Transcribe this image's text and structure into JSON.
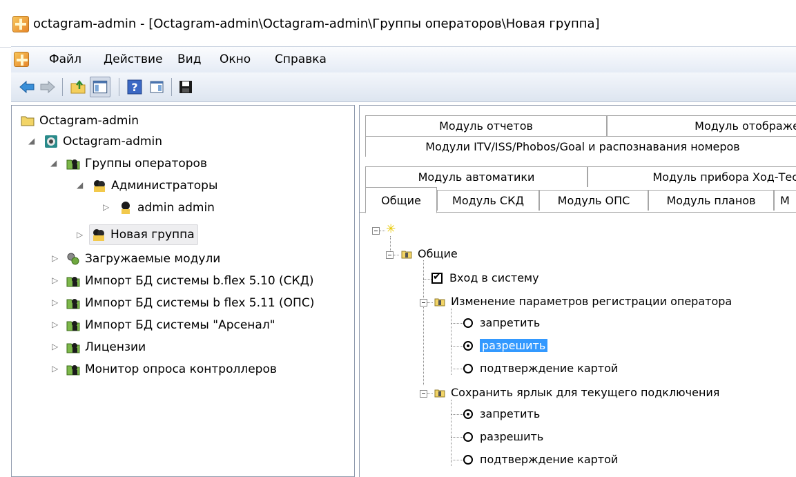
{
  "window": {
    "title": "octagram-admin - [Octagram-admin\\Octagram-admin\\Группы операторов\\Новая группа]"
  },
  "menu": {
    "items": [
      "Файл",
      "Действие",
      "Вид",
      "Окно",
      "Справка"
    ]
  },
  "toolbar": {
    "buttons": [
      "back-icon",
      "forward-icon",
      "up-folder-icon",
      "show-hide-tree-icon",
      "help-icon",
      "action-pane-icon",
      "save-icon"
    ]
  },
  "tree": {
    "root": "Octagram-admin",
    "server": "Octagram-admin",
    "operator_groups": "Группы операторов",
    "admins": "Администраторы",
    "admin_user": "admin admin",
    "new_group": "Новая группа",
    "loadable_modules": "Загружаемые модули",
    "import_bflex_510": "Импорт БД системы b.flex 5.10 (СКД)",
    "import_bflex_511": "Импорт БД системы b flex 5.11 (ОПС)",
    "import_arsenal": "Импорт БД системы \"Арсенал\"",
    "licenses": "Лицензии",
    "controller_monitor": "Монитор опроса контроллеров"
  },
  "tabs": {
    "row1": [
      "Модуль отчетов",
      "Модуль отображе"
    ],
    "row2": [
      "Модули ITV/ISS/Phobos/Goal и распознавания номеров"
    ],
    "row3": [
      "Модуль автоматики",
      "Модуль прибора Ход-Тес"
    ],
    "row4": [
      "Общие",
      "Модуль СКД",
      "Модуль ОПС",
      "Модуль планов",
      "М"
    ]
  },
  "permissions": {
    "group_general": "Общие",
    "login": "Вход в систему",
    "change_reg_params": "Изменение параметров регистрации оператора",
    "opt1_deny": "запретить",
    "opt1_allow": "разрешить",
    "opt1_card": "подтверждение картой",
    "save_shortcut": "Сохранить ярлык для текущего подключения",
    "opt2_deny": "запретить",
    "opt2_allow": "разрешить",
    "opt2_card": "подтверждение картой"
  }
}
